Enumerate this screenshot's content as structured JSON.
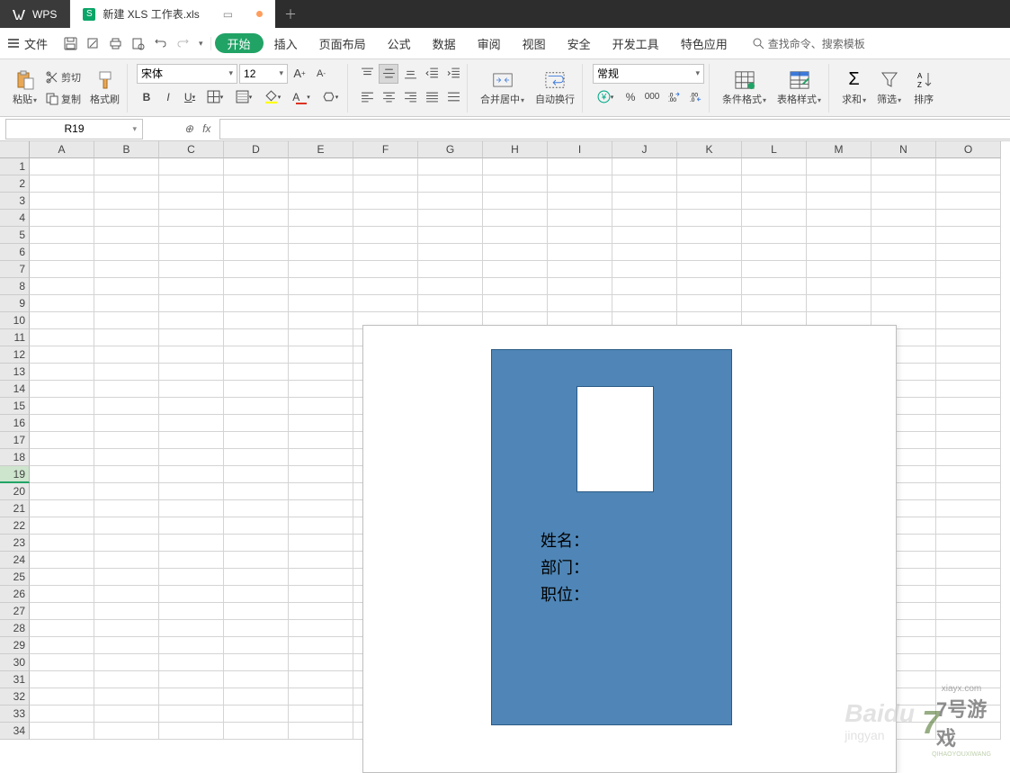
{
  "titlebar": {
    "wps_label": "WPS",
    "doc_name": "新建 XLS 工作表.xls"
  },
  "menubar": {
    "file": "文件",
    "tabs": [
      "开始",
      "插入",
      "页面布局",
      "公式",
      "数据",
      "审阅",
      "视图",
      "安全",
      "开发工具",
      "特色应用"
    ],
    "active_tab": 0,
    "search_placeholder": "查找命令、搜索模板"
  },
  "ribbon": {
    "paste": "粘贴",
    "cut": "剪切",
    "copy": "复制",
    "format_painter": "格式刷",
    "font_name": "宋体",
    "font_size": "12",
    "merge_center": "合并居中",
    "wrap_text": "自动换行",
    "number_format": "常规",
    "cond_fmt": "条件格式",
    "table_style": "表格样式",
    "sum": "求和",
    "filter": "筛选",
    "sort": "排序"
  },
  "namebar": {
    "cell_ref": "R19"
  },
  "sheet": {
    "columns": [
      "A",
      "B",
      "C",
      "D",
      "E",
      "F",
      "G",
      "H",
      "I",
      "J",
      "K",
      "L",
      "M",
      "N",
      "O"
    ],
    "rows": [
      "1",
      "2",
      "3",
      "4",
      "5",
      "6",
      "7",
      "8",
      "9",
      "10",
      "11",
      "12",
      "13",
      "14",
      "15",
      "16",
      "17",
      "18",
      "19",
      "20",
      "21",
      "22",
      "23",
      "24",
      "25",
      "26",
      "27",
      "28",
      "29",
      "30",
      "31",
      "32",
      "33",
      "34"
    ],
    "selected_row": 19
  },
  "card": {
    "name_label": "姓名：",
    "dept_label": "部门：",
    "role_label": "职位："
  },
  "watermark": {
    "baidu": "Baidu",
    "jingyan": "jingyan",
    "url": "xiayx.com",
    "site": "7号游戏",
    "pinyin": "QIHAOYOUXIWANG"
  }
}
